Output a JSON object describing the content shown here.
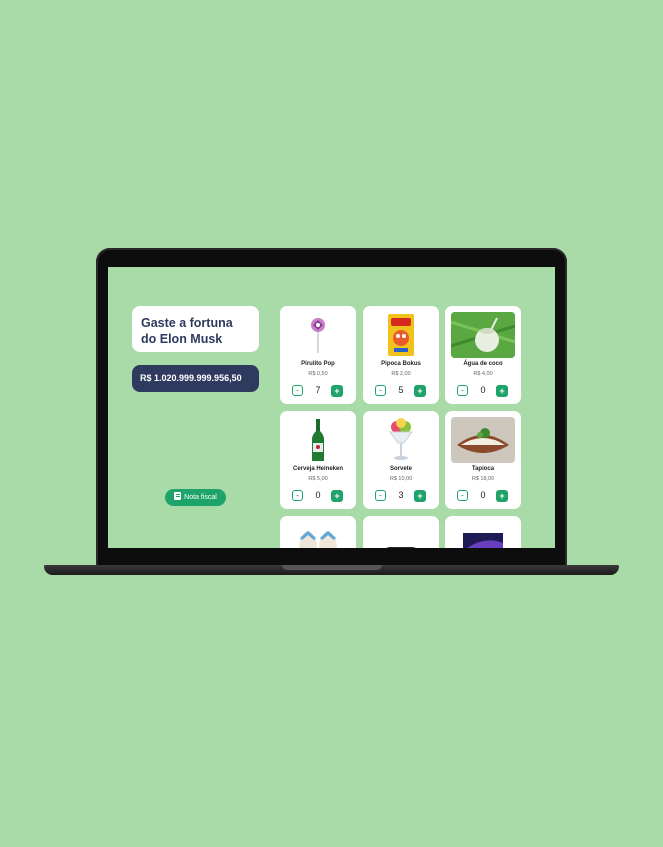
{
  "app": {
    "title_line1": "Gaste a fortuna",
    "title_line2": "do Elon Musk",
    "balance": "R$ 1.020.999.999.956,50",
    "invoice_button": "Nota fiscal"
  },
  "products": [
    {
      "name": "Pirulito Pop",
      "price": "R$ 0,50",
      "qty": "7",
      "minus": "-",
      "plus": "+",
      "icon": "lollipop-image"
    },
    {
      "name": "Pipoca Bokus",
      "price": "R$ 2,00",
      "qty": "5",
      "minus": "-",
      "plus": "+",
      "icon": "popcorn-bag-image"
    },
    {
      "name": "Água de coco",
      "price": "R$ 4,00",
      "qty": "0",
      "minus": "-",
      "plus": "+",
      "icon": "coconut-image"
    },
    {
      "name": "Cerveja Heineken",
      "price": "R$ 5,00",
      "qty": "0",
      "minus": "-",
      "plus": "+",
      "icon": "beer-bottle-image"
    },
    {
      "name": "Sorvete",
      "price": "R$ 10,00",
      "qty": "3",
      "minus": "-",
      "plus": "+",
      "icon": "ice-cream-image"
    },
    {
      "name": "Tapioca",
      "price": "R$ 18,00",
      "qty": "0",
      "minus": "-",
      "plus": "+",
      "icon": "tapioca-image"
    },
    {
      "icon": "flip-flops-image"
    },
    {
      "icon": "speaker-image"
    },
    {
      "icon": "tv-image"
    }
  ],
  "colors": {
    "background": "#a8dba7",
    "accent": "#1ea36a",
    "navy": "#2e3a5e"
  }
}
